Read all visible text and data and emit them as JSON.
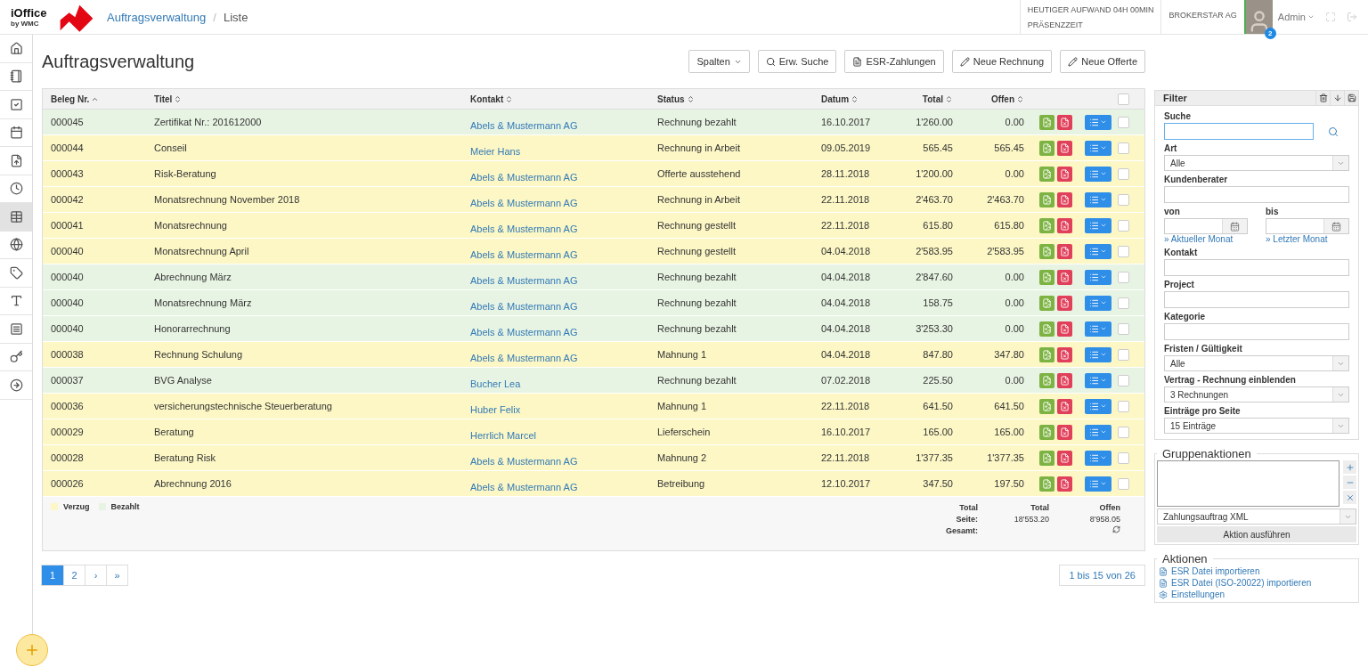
{
  "header": {
    "logo": {
      "name": "iOffice",
      "sub": "by WMC"
    },
    "breadcrumb": [
      {
        "label": "Auftragsverwaltung",
        "kind": "link"
      },
      {
        "label": "Liste",
        "kind": "current"
      }
    ],
    "breadcrumb_separator": "/",
    "stats": [
      "HEUTIGER AUFWAND 04H 00MIN",
      "PRÄSENZZEIT"
    ],
    "company": "BROKERSTAR AG",
    "user": "Admin",
    "notifications": "2"
  },
  "sidebar": {
    "items": [
      {
        "selected": false
      },
      {
        "selected": false
      },
      {
        "selected": false
      },
      {
        "selected": false
      },
      {
        "selected": false
      },
      {
        "selected": false
      },
      {
        "selected": true
      },
      {
        "selected": false
      },
      {
        "selected": false
      },
      {
        "selected": false
      },
      {
        "selected": false
      },
      {
        "selected": false
      },
      {
        "selected": false
      }
    ]
  },
  "page_title": "Auftragsverwaltung",
  "toolbar": [
    {
      "label": "Spalten",
      "kind": "dropdown"
    },
    {
      "label": "Erw. Suche",
      "kind": "search"
    },
    {
      "label": "ESR-Zahlungen",
      "kind": "file"
    },
    {
      "label": "Neue Rechnung",
      "kind": "pencil"
    },
    {
      "label": "Neue Offerte",
      "kind": "pencil"
    }
  ],
  "table": {
    "columns": [
      {
        "label": "Beleg Nr.",
        "sorted": true
      },
      {
        "label": "Titel",
        "sorted": false
      },
      {
        "label": "Kontakt",
        "sorted": false
      },
      {
        "label": "Status",
        "sorted": false
      },
      {
        "label": "Datum",
        "sorted": false
      },
      {
        "label": "Total",
        "sorted": false
      },
      {
        "label": "Offen",
        "sorted": false
      }
    ],
    "all_checked": false,
    "rows": [
      {
        "cells": [
          "000045",
          "Zertifikat Nr.: 201612000",
          "Abels & Mustermann AG",
          "Rechnung bezahlt",
          "16.10.2017",
          "1'260.00",
          "0.00"
        ],
        "color": "#e8f4e3",
        "checked": false
      },
      {
        "cells": [
          "000044",
          "Conseil",
          "Meier Hans",
          "Rechnung in Arbeit",
          "09.05.2019",
          "565.45",
          "565.45"
        ],
        "color": "#fcf7c5",
        "checked": false
      },
      {
        "cells": [
          "000043",
          "Risk-Beratung",
          "Abels & Mustermann AG",
          "Offerte ausstehend",
          "28.11.2018",
          "1'200.00",
          "0.00"
        ],
        "color": "#fcf7c5",
        "checked": false
      },
      {
        "cells": [
          "000042",
          "Monatsrechnung November 2018",
          "Abels & Mustermann AG",
          "Rechnung in Arbeit",
          "22.11.2018",
          "2'463.70",
          "2'463.70"
        ],
        "color": "#fcf7c5",
        "checked": false
      },
      {
        "cells": [
          "000041",
          "Monatsrechnung",
          "Abels & Mustermann AG",
          "Rechnung gestellt",
          "22.11.2018",
          "615.80",
          "615.80"
        ],
        "color": "#fcf7c5",
        "checked": false
      },
      {
        "cells": [
          "000040",
          "Monatsrechnung April",
          "Abels & Mustermann AG",
          "Rechnung gestellt",
          "04.04.2018",
          "2'583.95",
          "2'583.95"
        ],
        "color": "#fcf7c5",
        "checked": false
      },
      {
        "cells": [
          "000040",
          "Abrechnung März",
          "Abels & Mustermann AG",
          "Rechnung bezahlt",
          "04.04.2018",
          "2'847.60",
          "0.00"
        ],
        "color": "#e8f4e3",
        "checked": false
      },
      {
        "cells": [
          "000040",
          "Monatsrechnung März",
          "Abels & Mustermann AG",
          "Rechnung bezahlt",
          "04.04.2018",
          "158.75",
          "0.00"
        ],
        "color": "#e8f4e3",
        "checked": false
      },
      {
        "cells": [
          "000040",
          "Honorarrechnung",
          "Abels & Mustermann AG",
          "Rechnung bezahlt",
          "04.04.2018",
          "3'253.30",
          "0.00"
        ],
        "color": "#e8f4e3",
        "checked": false
      },
      {
        "cells": [
          "000038",
          "Rechnung Schulung",
          "Abels & Mustermann AG",
          "Mahnung 1",
          "04.04.2018",
          "847.80",
          "347.80"
        ],
        "color": "#fcf7c5",
        "checked": false
      },
      {
        "cells": [
          "000037",
          "BVG Analyse",
          "Bucher Lea",
          "Rechnung bezahlt",
          "07.02.2018",
          "225.50",
          "0.00"
        ],
        "color": "#e8f4e3",
        "checked": false
      },
      {
        "cells": [
          "000036",
          "versicherungstechnische Steuerberatung",
          "Huber Felix",
          "Mahnung 1",
          "22.11.2018",
          "641.50",
          "641.50"
        ],
        "color": "#fcf7c5",
        "checked": false
      },
      {
        "cells": [
          "000029",
          "Beratung",
          "Herrlich Marcel",
          "Lieferschein",
          "16.10.2017",
          "165.00",
          "165.00"
        ],
        "color": "#fcf7c5",
        "checked": false
      },
      {
        "cells": [
          "000028",
          "Beratung Risk",
          "Abels & Mustermann AG",
          "Mahnung 2",
          "22.11.2018",
          "1'377.35",
          "1'377.35"
        ],
        "color": "#fcf7c5",
        "checked": false
      },
      {
        "cells": [
          "000026",
          "Abrechnung 2016",
          "Abels & Mustermann AG",
          "Betreibung",
          "12.10.2017",
          "347.50",
          "197.50"
        ],
        "color": "#fcf7c5",
        "checked": false
      }
    ],
    "legend": [
      {
        "label": "Verzug",
        "color": "#fcf7c5"
      },
      {
        "label": "Bezahlt",
        "color": "#e8f4e3"
      }
    ],
    "totals": {
      "labels": [
        "Total",
        "Seite:",
        "Gesamt:"
      ],
      "total": [
        "Total",
        "18'553.20"
      ],
      "open": [
        "Offen",
        "8'958.05"
      ]
    }
  },
  "pagination": {
    "pages": [
      {
        "label": "1",
        "selected": true
      },
      {
        "label": "2",
        "selected": false
      },
      {
        "label": "›",
        "selected": false
      },
      {
        "label": "»",
        "selected": false
      }
    ],
    "range": "1 bis 15 von 26"
  },
  "filter": {
    "title": "Filter",
    "fields": [
      {
        "kind": "search",
        "label": "Suche"
      },
      {
        "kind": "select",
        "label": "Art",
        "value": "Alle"
      },
      {
        "kind": "text",
        "label": "Kundenberater"
      },
      {
        "kind": "dates",
        "from": {
          "label": "von",
          "link": "» Aktueller Monat"
        },
        "to": {
          "label": "bis",
          "link": "» Letzter Monat"
        }
      },
      {
        "kind": "text",
        "label": "Kontakt"
      },
      {
        "kind": "text",
        "label": "Project"
      },
      {
        "kind": "text",
        "label": "Kategorie"
      },
      {
        "kind": "select",
        "label": "Fristen / Gültigkeit",
        "value": "Alle"
      },
      {
        "kind": "select",
        "label": "Vertrag - Rechnung einblenden",
        "value": "3 Rechnungen"
      },
      {
        "kind": "select",
        "label": "Einträge pro Seite",
        "value": "15 Einträge"
      }
    ]
  },
  "group_actions": {
    "title": "Gruppenaktionen",
    "action": "Zahlungsauftrag XML",
    "button": "Aktion ausführen"
  },
  "actions": {
    "title": "Aktionen",
    "items": [
      {
        "label": "ESR Datei importieren",
        "kind": "import"
      },
      {
        "label": "ESR Datei (ISO-20022) importieren",
        "kind": "import"
      },
      {
        "label": "Einstellungen",
        "kind": "settings"
      }
    ]
  }
}
